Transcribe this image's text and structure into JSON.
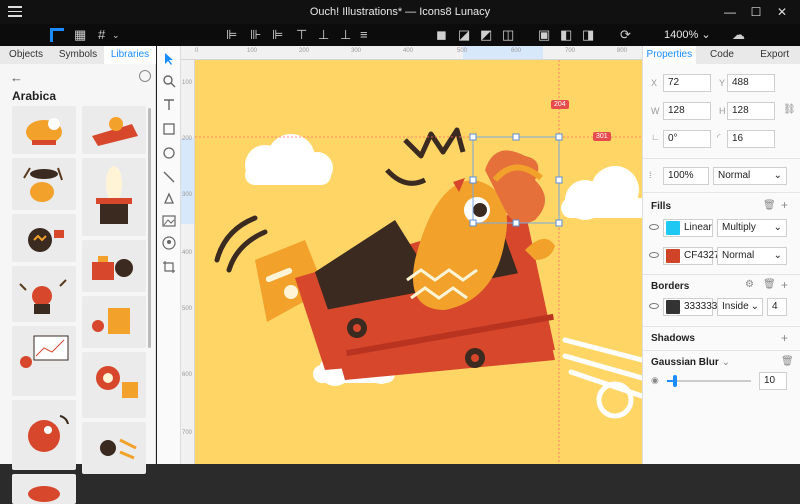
{
  "window": {
    "title": "Ouch! Illustrations* — Icons8 Lunacy"
  },
  "toolbar": {
    "zoom": "1400%"
  },
  "left_panel": {
    "tabs": [
      {
        "label": "Objects",
        "active": false
      },
      {
        "label": "Symbols",
        "active": false
      },
      {
        "label": "Libraries",
        "active": true
      }
    ],
    "library_title": "Arabica"
  },
  "canvas": {
    "badge_top": "204",
    "badge_right": "301",
    "ruler_top_ticks": [
      "0",
      "100",
      "200",
      "300",
      "400",
      "500",
      "600",
      "700",
      "800"
    ],
    "ruler_left_ticks": [
      "100",
      "200",
      "300",
      "400",
      "500",
      "600",
      "700"
    ]
  },
  "right_panel": {
    "tabs": [
      {
        "label": "Properties",
        "active": true
      },
      {
        "label": "Code",
        "active": false
      },
      {
        "label": "Export",
        "active": false
      }
    ],
    "x_label": "X",
    "x_value": "72",
    "y_label": "Y",
    "y_value": "488",
    "w_label": "W",
    "w_value": "128",
    "h_label": "H",
    "h_value": "128",
    "rotation_value": "0°",
    "radius_value": "16",
    "opacity_value": "100%",
    "blend_value": "Normal",
    "fills_title": "Fills",
    "fills": [
      {
        "type": "Linear",
        "blend": "Multiply",
        "color": "#1ec8f2"
      },
      {
        "type": "CF4327",
        "blend": "Normal",
        "color": "#cf4327"
      }
    ],
    "borders_title": "Borders",
    "border": {
      "color_label": "333333",
      "color": "#333333",
      "position": "Inside",
      "width": "4"
    },
    "shadows_title": "Shadows",
    "blur_title": "Gaussian Blur",
    "blur_value": "10",
    "blur_level": 0.1
  },
  "colors": {
    "accent": "#1a8cff",
    "canvas": "#ffd666",
    "badge": "#e74c4c"
  }
}
